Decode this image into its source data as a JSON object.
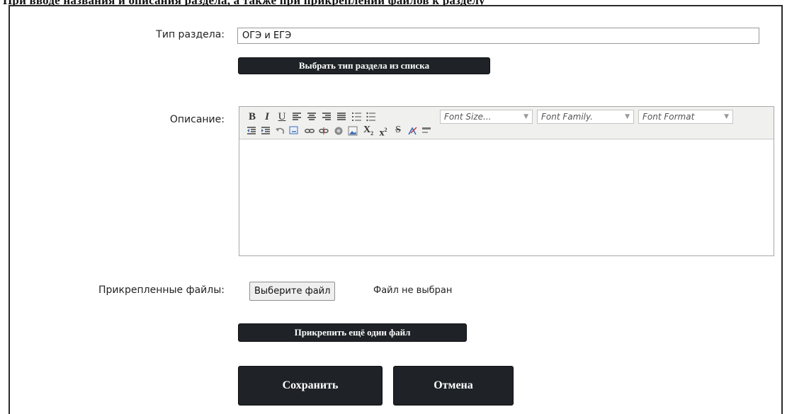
{
  "top_text": "При вводе названия и описания раздела, а также при прикреплении файлов к разделу",
  "form": {
    "section_type_label": "Тип раздела:",
    "section_type_value": "ОГЭ и ЕГЭ",
    "choose_section_type_button": "Выбрать тип раздела из списка",
    "description_label": "Описание:",
    "attached_files_label": "Прикрепленные файлы:",
    "file_button": "Выберите файл",
    "file_status": "Файл не выбран",
    "attach_more_button": "Прикрепить ещё один файл",
    "save_button": "Сохранить",
    "cancel_button": "Отмена"
  },
  "editor": {
    "bold": "B",
    "italic": "I",
    "underline": "U",
    "font_size": "Font Size...",
    "font_family": "Font Family.",
    "font_format": "Font Format",
    "subscript": "X",
    "subscript_mark": "2",
    "superscript": "x",
    "superscript_mark": "2",
    "strike": "S",
    "content": ""
  },
  "colors": {
    "button_dark": "#1f2327",
    "toolbar_bg": "#f0f0ee",
    "icon_accent": "#3b6fb5"
  }
}
